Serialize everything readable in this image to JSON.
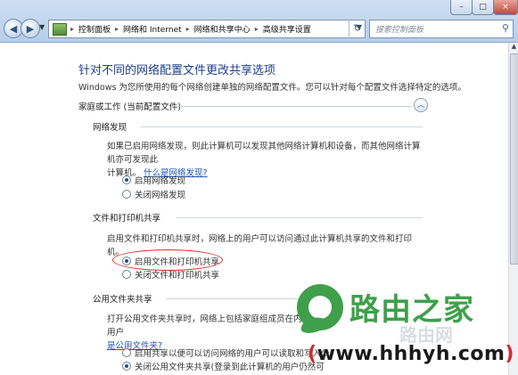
{
  "window": {
    "controls": [
      "–",
      "□",
      "×"
    ]
  },
  "nav": {
    "back_icon": "back-arrow-icon",
    "forward_icon": "forward-arrow-icon"
  },
  "address": {
    "breadcrumbs": [
      "控制面板",
      "网络和 Internet",
      "网络和共享中心",
      "高级共享设置"
    ],
    "separator": "▸"
  },
  "search": {
    "placeholder": "搜索控制面板"
  },
  "page": {
    "title": "针对不同的网络配置文件更改共享选项",
    "description": "Windows 为您所使用的每个网络创建单独的网络配置文件。您可以针对每个配置文件选择特定的选项。",
    "profile_label": "家庭或工作 (当前配置文件)"
  },
  "sections": {
    "network_discovery": {
      "title": "网络发现",
      "text1": "如果已启用网络发现，则此计算机可以发现其他网络计算机和设备，而其他网络计算机亦可发现此",
      "text2": "计算机。",
      "link": "什么是网络发现?",
      "option_on": "启用网络发现",
      "option_off": "关闭网络发现"
    },
    "file_printer": {
      "title": "文件和打印机共享",
      "text": "启用文件和打印机共享时，网络上的用户可以访问通过此计算机共享的文件和打印机。",
      "option_on": "启用文件和打印机共享",
      "option_off": "关闭文件和打印机共享"
    },
    "public_folder": {
      "title": "公用文件夹共享",
      "text": "打开公用文件夹共享时，网络上包括家庭组成员在内的用户",
      "link": "是公用文件夹?",
      "option_on": "启用共享以便可以访问网络的用户可以读取和写入公",
      "option_off": "关闭公用文件夹共享(登录到此计算机的用户仍然可"
    }
  },
  "watermark": {
    "brand": "路由之家",
    "faint": "路由网",
    "url_open": "(",
    "url": "www.hhhyh.com",
    "url_close": ")"
  }
}
